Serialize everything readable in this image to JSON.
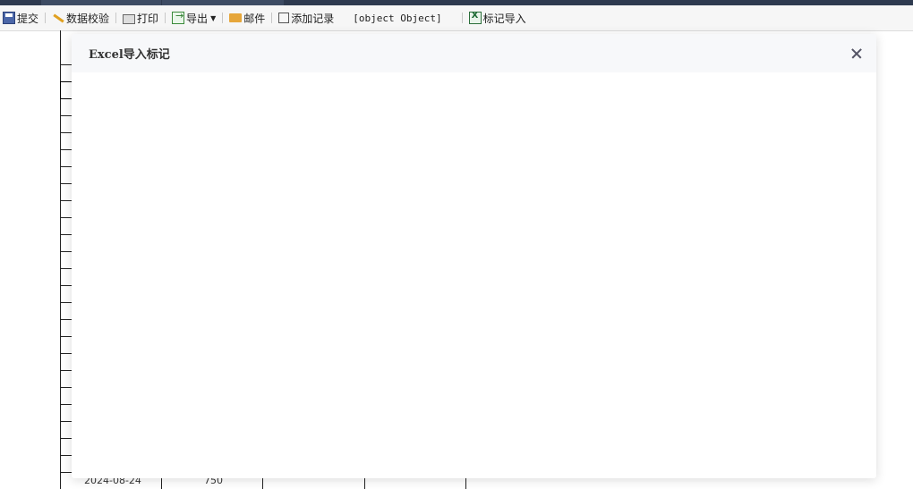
{
  "toolbar": {
    "submit": "提交",
    "validate": "数据校验",
    "print": "打印",
    "export": "导出",
    "mail": "邮件",
    "add_record": "添加记录",
    "object_text": "[object Object]",
    "mark_import": "标记导入"
  },
  "background": {
    "row_date": "2024-08-24",
    "row_value": "750"
  },
  "modal": {
    "title": "Excel导入标记"
  }
}
